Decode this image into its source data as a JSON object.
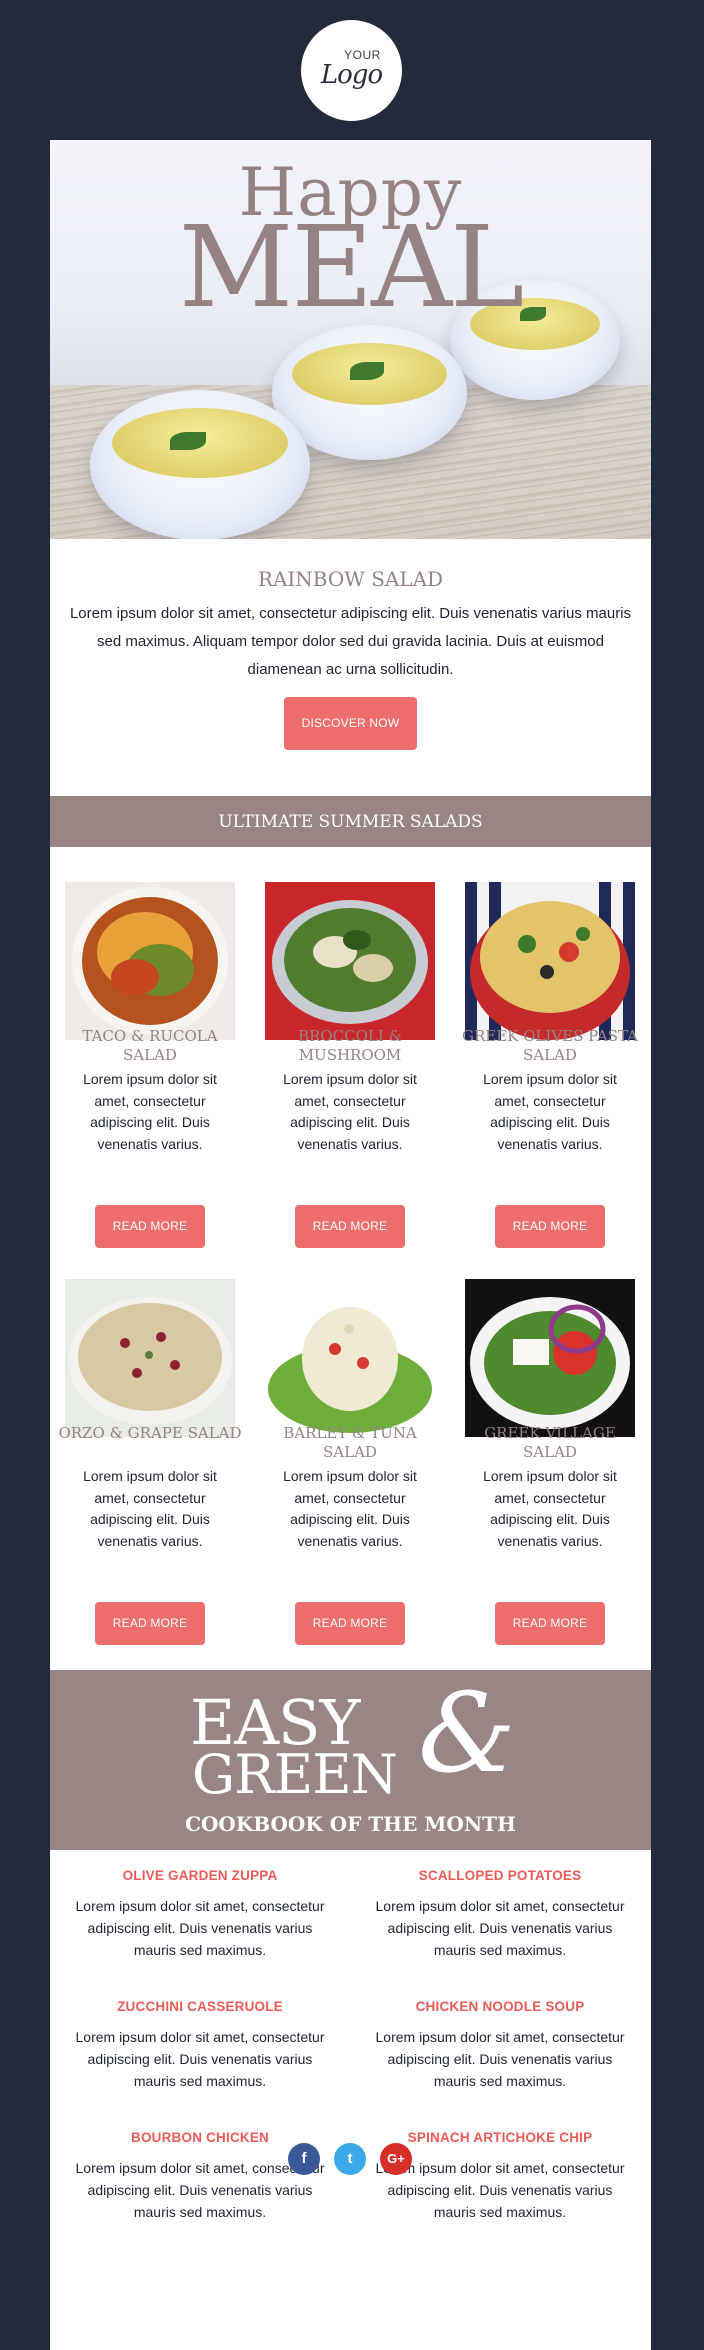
{
  "logo": {
    "your": "YOUR",
    "word": "Logo"
  },
  "hero": {
    "line1": "Happy",
    "line2": "MEAL"
  },
  "feature": {
    "title": "RAINBOW SALAD",
    "text": "Lorem ipsum dolor sit amet, consectetur adipiscing elit. Duis venenatis varius mauris sed maximus. Aliquam tempor dolor sed dui gravida lacinia. Duis at euismod diamenean ac urna sollicitudin.",
    "button": "DISCOVER NOW"
  },
  "section_title": "ULTIMATE SUMMER SALADS",
  "products": [
    {
      "title": "TACO & RUCOLA SALAD",
      "desc": "Lorem ipsum dolor sit amet, consectetur adipiscing elit. Duis venenatis varius.",
      "button": "READ MORE"
    },
    {
      "title": "BROCCOLI & MUSHROOM",
      "desc": "Lorem ipsum dolor sit amet, consectetur adipiscing elit. Duis venenatis varius.",
      "button": "READ MORE"
    },
    {
      "title": "GREEK OLIVES PASTA SALAD",
      "desc": "Lorem ipsum dolor sit amet, consectetur adipiscing elit. Duis venenatis varius.",
      "button": "READ MORE"
    },
    {
      "title": "ORZO & GRAPE SALAD",
      "desc": "Lorem ipsum dolor sit amet, consectetur adipiscing elit. Duis venenatis varius.",
      "button": "READ MORE"
    },
    {
      "title": "BARLEY & TUNA SALAD",
      "desc": "Lorem ipsum dolor sit amet, consectetur adipiscing elit. Duis venenatis varius.",
      "button": "READ MORE"
    },
    {
      "title": "GREEK VILLAGE SALAD",
      "desc": "Lorem ipsum dolor sit amet, consectetur adipiscing elit. Duis venenatis varius.",
      "button": "READ MORE"
    }
  ],
  "cookbook": {
    "easy": "EASY",
    "green": "GREEN",
    "amp": "&",
    "subtitle": "COOKBOOK OF THE MONTH"
  },
  "recipes": [
    {
      "title": "OLIVE GARDEN ZUPPA",
      "desc": "Lorem ipsum dolor sit amet, consectetur adipiscing elit. Duis venenatis varius mauris sed maximus."
    },
    {
      "title": "SCALLOPED POTATOES",
      "desc": "Lorem ipsum dolor sit amet, consectetur adipiscing elit. Duis venenatis varius mauris sed maximus."
    },
    {
      "title": "ZUCCHINI CASSERUOLE",
      "desc": "Lorem ipsum dolor sit amet, consectetur adipiscing elit. Duis venenatis varius mauris sed maximus."
    },
    {
      "title": "CHICKEN NOODLE SOUP",
      "desc": "Lorem ipsum dolor sit amet, consectetur adipiscing elit. Duis venenatis varius mauris sed maximus."
    },
    {
      "title": "BOURBON CHICKEN",
      "desc": "Lorem ipsum dolor sit amet, consectetur adipiscing elit. Duis venenatis varius mauris sed maximus."
    },
    {
      "title": "SPINACH ARTICHOKE CHIP",
      "desc": "Lorem ipsum dolor sit amet, consectetur adipiscing elit. Duis venenatis varius mauris sed maximus."
    }
  ],
  "social": [
    {
      "icon": "facebook-icon",
      "glyph": "f",
      "color": "#3b5998"
    },
    {
      "icon": "twitter-icon",
      "glyph": "t",
      "color": "#3ba9e8"
    },
    {
      "icon": "google-plus-icon",
      "glyph": "G+",
      "color": "#d52f2a"
    }
  ],
  "colors": {
    "background": "#232a3b",
    "accent": "#ed6e6c",
    "mauve": "#9a8585",
    "title": "#958383"
  }
}
